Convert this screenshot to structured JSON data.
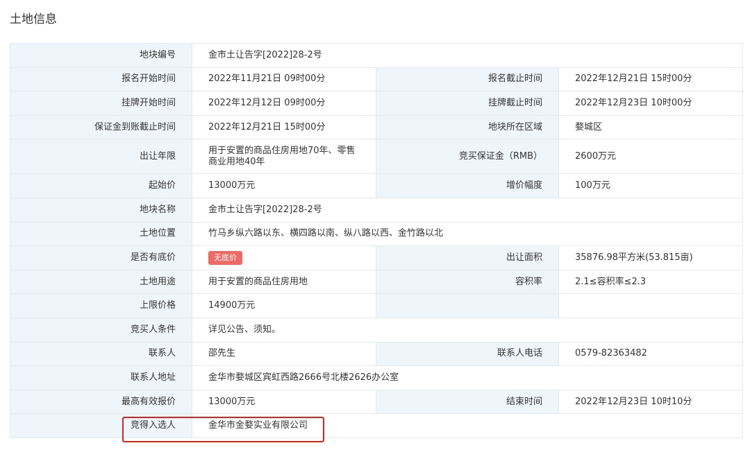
{
  "page": {
    "title": "土地信息"
  },
  "colors": {
    "label_bg": "#eef6fb",
    "border": "#e3e9ee",
    "badge_bg": "#f06a65",
    "highlight": "#e0201b"
  },
  "rows": {
    "parcel_no": {
      "label": "地块编号",
      "value": "金市土让告字[2022]28-2号"
    },
    "reg_start": {
      "label": "报名开始时间",
      "value": "2022年11月21日 09时00分"
    },
    "reg_end": {
      "label": "报名截止时间",
      "value": "2022年12月21日 15时00分"
    },
    "list_start": {
      "label": "挂牌开始时间",
      "value": "2022年12月12日 09时00分"
    },
    "list_end": {
      "label": "挂牌截止时间",
      "value": "2022年12月23日 10时00分"
    },
    "deposit_deadline": {
      "label": "保证金到账截止时间",
      "value": "2022年12月21日 15时00分"
    },
    "district": {
      "label": "地块所在区域",
      "value": "婺城区"
    },
    "term": {
      "label": "出让年限",
      "value": "用于安置的商品住房用地70年、零售商业用地40年"
    },
    "deposit": {
      "label": "竞买保证金（RMB）",
      "value": "2600万元"
    },
    "start_price": {
      "label": "起始价",
      "value": "13000万元"
    },
    "increment": {
      "label": "增价幅度",
      "value": "100万元"
    },
    "parcel_name": {
      "label": "地块名称",
      "value": "金市土让告字[2022]28-2号"
    },
    "location": {
      "label": "土地位置",
      "value": "竹马乡纵六路以东、横四路以南、纵八路以西、金竹路以北"
    },
    "reserve": {
      "label": "是否有底价",
      "badge": "无底价"
    },
    "area": {
      "label": "出让面积",
      "value": "35876.98平方米(53.815亩)"
    },
    "usage": {
      "label": "土地用途",
      "value": "用于安置的商品住房用地"
    },
    "far": {
      "label": "容积率",
      "value": "2.1≤容积率≤2.3"
    },
    "cap_price": {
      "label": "上限价格",
      "value": "14900万元"
    },
    "bidder_req": {
      "label": "竞买人条件",
      "value": "详见公告、须知。"
    },
    "contact": {
      "label": "联系人",
      "value": "邵先生"
    },
    "phone": {
      "label": "联系人电话",
      "value": "0579-82363482"
    },
    "address": {
      "label": "联系人地址",
      "value": "金华市婺城区宾虹西路2666号北楼2626办公室"
    },
    "top_bid": {
      "label": "最高有效报价",
      "value": "13000万元"
    },
    "end_time": {
      "label": "结束时间",
      "value": "2022年12月23日 10时10分"
    },
    "winner": {
      "label": "竞得入选人",
      "value": "金华市金婺实业有限公司"
    }
  }
}
